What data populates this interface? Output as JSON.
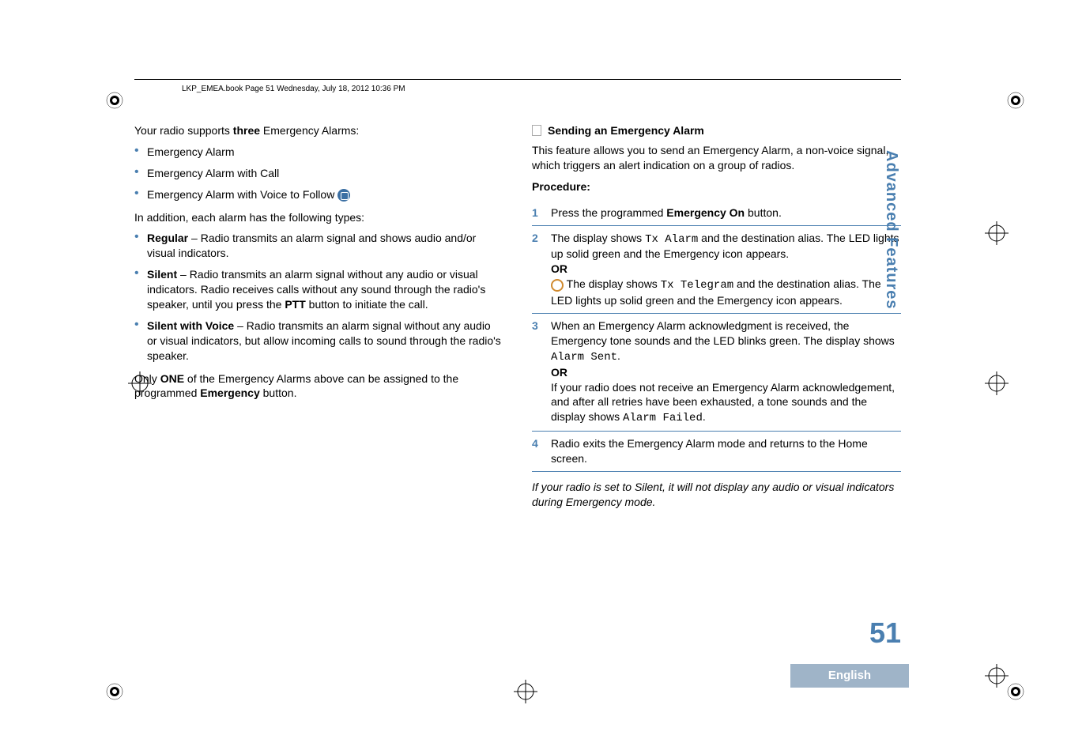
{
  "header": "LKP_EMEA.book  Page 51  Wednesday, July 18, 2012  10:36 PM",
  "left": {
    "intro_pre": "Your radio supports ",
    "intro_bold": "three",
    "intro_post": " Emergency Alarms:",
    "alarms": [
      "Emergency Alarm",
      "Emergency Alarm with Call",
      "Emergency Alarm with Voice to Follow"
    ],
    "types_intro": "In addition, each alarm has the following types:",
    "types": [
      {
        "name": "Regular",
        "dash": " – ",
        "desc": "Radio transmits an alarm signal and shows audio and/or visual indicators."
      },
      {
        "name": "Silent",
        "dash": " – ",
        "desc_pre": "Radio transmits an alarm signal without any audio or visual indicators. Radio receives calls without any sound through the radio's speaker, until you press the ",
        "ptt": "PTT",
        "desc_post": " button to initiate the call."
      },
      {
        "name": "Silent with Voice",
        "dash": " – ",
        "desc": "Radio transmits an alarm signal without any audio or visual indicators, but allow incoming calls to sound through the radio's speaker."
      }
    ],
    "only_pre": "Only ",
    "only_one": "ONE",
    "only_mid": " of the Emergency Alarms above can be assigned to the programmed ",
    "only_emerg": "Emergency",
    "only_post": " button."
  },
  "right": {
    "heading": "Sending an Emergency Alarm",
    "intro": "This feature allows you to send an Emergency Alarm, a non-voice signal, which triggers an alert indication on a group of radios.",
    "procedure_label": "Procedure:",
    "steps": {
      "s1_pre": "Press the programmed ",
      "s1_bold": "Emergency On",
      "s1_post": " button.",
      "s2_pre": "The display shows ",
      "s2_mono1": "Tx Alarm",
      "s2_mid": " and the destination alias. The LED lights up solid green and the Emergency icon appears.",
      "or": "OR",
      "s2b_pre": " The display shows ",
      "s2b_mono": "Tx Telegram",
      "s2b_post": " and the destination alias. The LED lights up solid green and the Emergency icon appears.",
      "s3_pre": "When an Emergency Alarm acknowledgment is received, the Emergency tone sounds and the LED blinks green. The display shows ",
      "s3_mono1": "Alarm Sent",
      "s3_mid": ".",
      "s3b": "If your radio does not receive an Emergency Alarm acknowledgement, and after all retries have been exhausted, a tone sounds and the display shows ",
      "s3_mono2": "Alarm Failed",
      "s3_post": ".",
      "s4": "Radio exits the Emergency Alarm mode and returns to the Home screen."
    },
    "note": "If your radio is set to Silent, it will not display any audio or visual indicators during Emergency mode."
  },
  "side": {
    "section": "Advanced Features",
    "page": "51",
    "lang": "English"
  }
}
